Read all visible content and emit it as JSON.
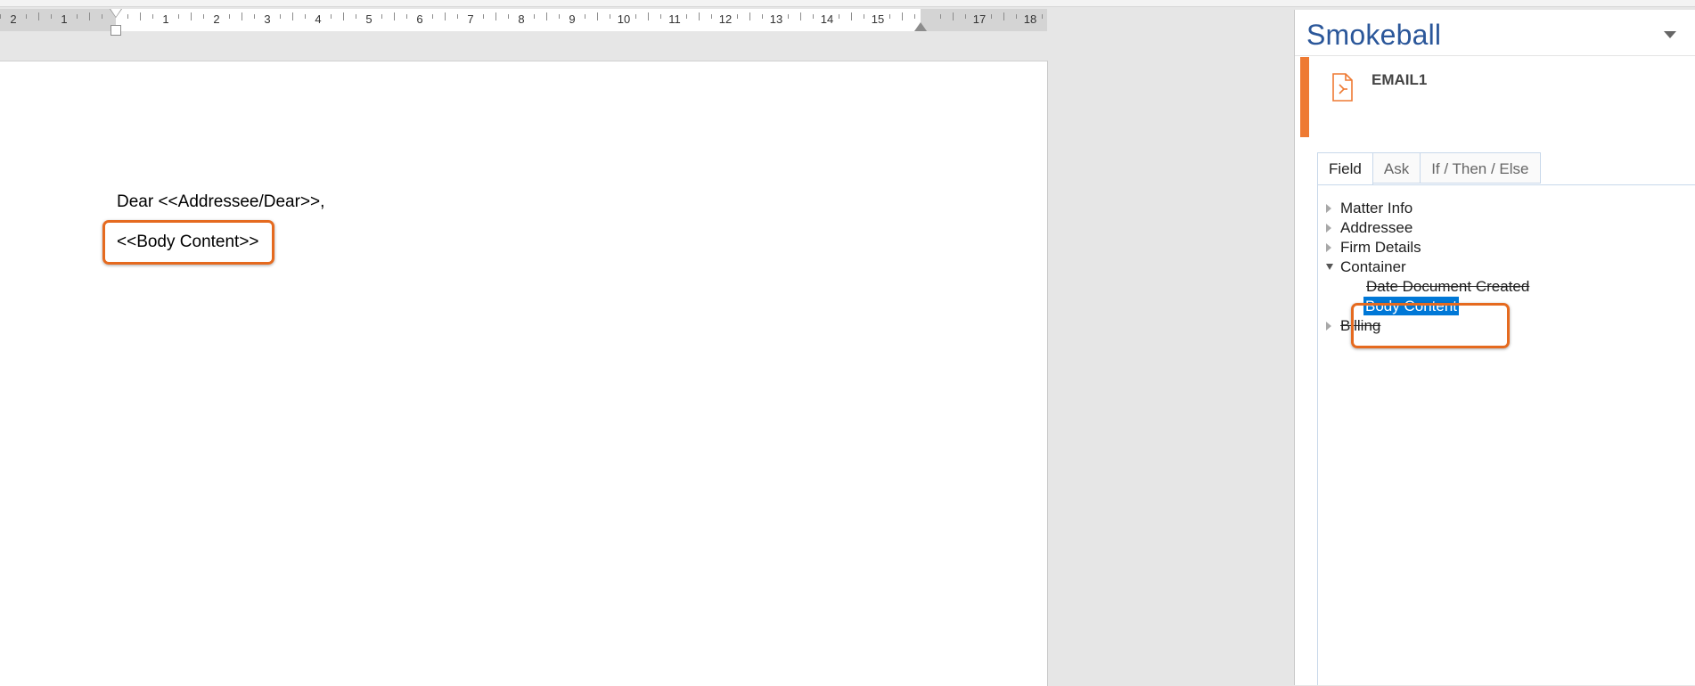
{
  "ruler": {
    "numbers": [
      "2",
      "1",
      "1",
      "2",
      "3",
      "4",
      "5",
      "6",
      "7",
      "8",
      "9",
      "10",
      "11",
      "12",
      "13",
      "14",
      "15",
      "17",
      "18"
    ]
  },
  "document": {
    "line1": "Dear <<Addressee/Dear>>,",
    "line2": "<<Body Content>>"
  },
  "pane": {
    "title": "Smokeball",
    "doc_item": {
      "name": "EMAIL1",
      "icon": "document-icon"
    },
    "tabs": [
      {
        "label": "Field",
        "active": true
      },
      {
        "label": "Ask",
        "active": false
      },
      {
        "label": "If / Then / Else",
        "active": false
      }
    ],
    "tree": [
      {
        "label": "Matter Info",
        "state": "collapsed"
      },
      {
        "label": "Addressee",
        "state": "collapsed"
      },
      {
        "label": "Firm Details",
        "state": "collapsed"
      },
      {
        "label": "Container",
        "state": "expanded",
        "children": [
          {
            "label": "Date Document Created"
          },
          {
            "label": "Body Content",
            "selected": true
          }
        ]
      },
      {
        "label": "Billing",
        "state": "collapsed"
      }
    ]
  },
  "colors": {
    "accent": "#ee7a33",
    "highlight_box": "#e56a1f",
    "title_blue": "#2b579a",
    "selection": "#0078d7"
  }
}
